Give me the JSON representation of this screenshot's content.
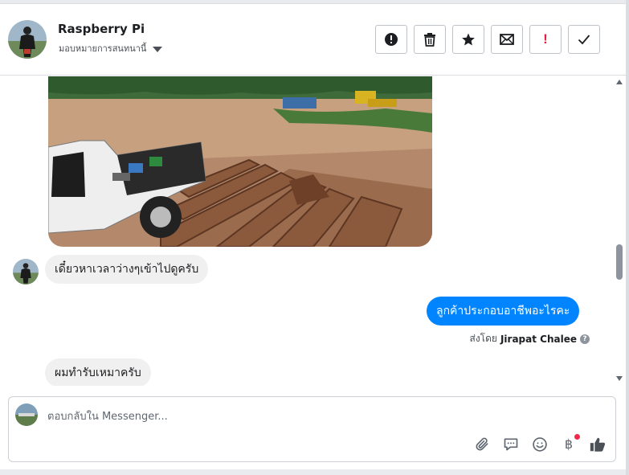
{
  "colors": {
    "accent": "#0084ff",
    "incoming_bubble": "#f1f0f0",
    "mark_spam": "#e41e3f",
    "unread_dot": "#f02849"
  },
  "header": {
    "contact_name": "Raspberry Pi",
    "assign_label": "มอบหมายการสนทนานี้",
    "actions": [
      {
        "icon": "alert-circle-icon"
      },
      {
        "icon": "trash-icon"
      },
      {
        "icon": "star-icon"
      },
      {
        "icon": "envelope-icon"
      },
      {
        "icon": "exclamation-icon",
        "glyph": "!"
      },
      {
        "icon": "checkmark-icon"
      }
    ]
  },
  "thread": {
    "messages": [
      {
        "direction": "incoming",
        "type": "image",
        "icon": "photo-construction-site"
      },
      {
        "direction": "incoming",
        "text": "เดี๋ยวหาเวลาว่างๆเข้าไปดูครับ"
      },
      {
        "direction": "outgoing",
        "text": "ลูกค้าประกอบอาชีพอะไรคะ"
      },
      {
        "direction": "incoming",
        "text": "ผมทำรับเหมาครับ"
      }
    ],
    "sent_by_prefix": "ส่งโดย",
    "sent_by_name": "Jirapat Chalee",
    "info_glyph": "?"
  },
  "composer": {
    "placeholder": "ตอบกลับใน Messenger...",
    "value": "",
    "icons": [
      "paperclip-icon",
      "saved-replies-icon",
      "emoji-icon",
      "baht-payment-icon",
      "thumbs-up-icon"
    ],
    "baht_glyph": "฿"
  }
}
